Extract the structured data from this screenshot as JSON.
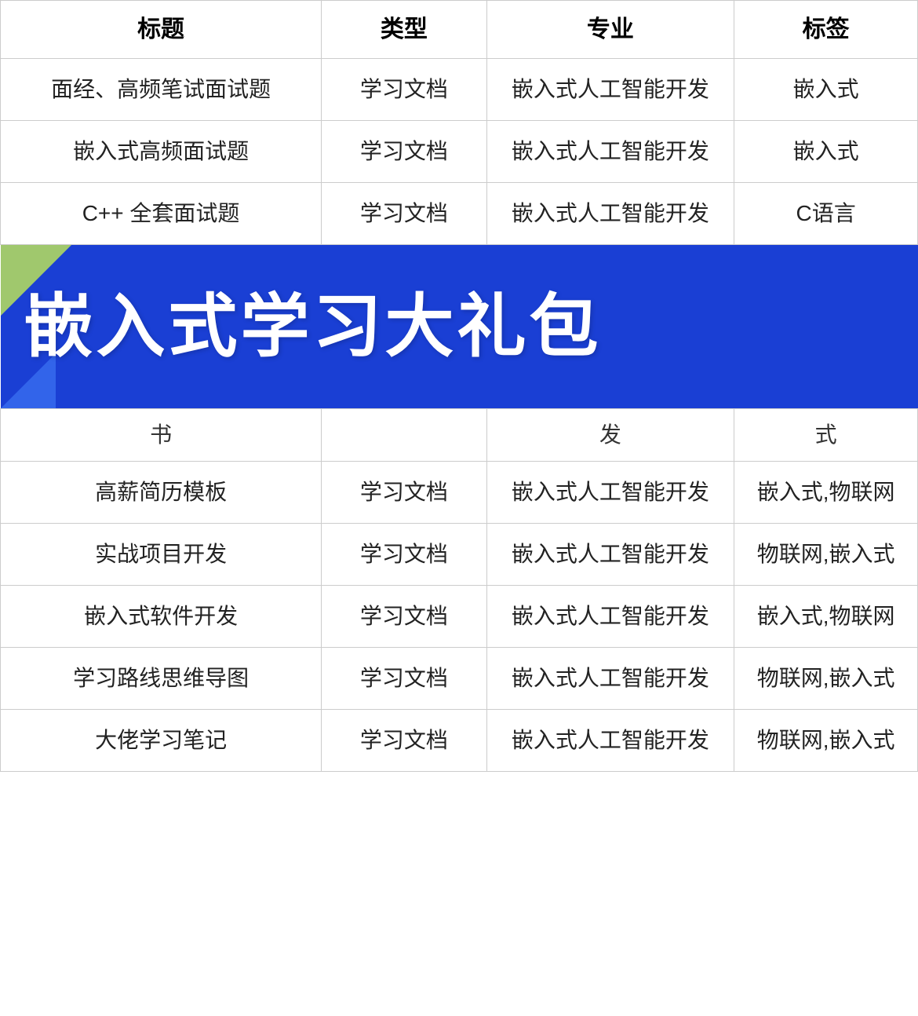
{
  "table": {
    "headers": [
      "标题",
      "类型",
      "专业",
      "标签"
    ],
    "rows": [
      {
        "title": "面经、高频笔试面试题",
        "type": "学习文档",
        "major": "嵌入式人工智能开发",
        "tag": "嵌入式"
      },
      {
        "title": "嵌入式高频面试题",
        "type": "学习文档",
        "major": "嵌入式人工智能开发",
        "tag": "嵌入式"
      },
      {
        "title": "C++ 全套面试题",
        "type": "学习文档",
        "major": "嵌入式人工智能开发",
        "tag": "C语言"
      }
    ],
    "banner_text": "嵌入式学习大礼包",
    "partial_row": {
      "title": "书",
      "major": "发",
      "tag": "式"
    },
    "rows_after": [
      {
        "title": "高薪简历模板",
        "type": "学习文档",
        "major": "嵌入式人工智能开发",
        "tag": "嵌入式,物联网"
      },
      {
        "title": "实战项目开发",
        "type": "学习文档",
        "major": "嵌入式人工智能开发",
        "tag": "物联网,嵌入式"
      },
      {
        "title": "嵌入式软件开发",
        "type": "学习文档",
        "major": "嵌入式人工智能开发",
        "tag": "嵌入式,物联网"
      },
      {
        "title": "学习路线思维导图",
        "type": "学习文档",
        "major": "嵌入式人工智能开发",
        "tag": "物联网,嵌入式"
      },
      {
        "title": "大佬学习笔记",
        "type": "学习文档",
        "major": "嵌入式人工智能开发",
        "tag": "物联网,嵌入式"
      }
    ]
  }
}
